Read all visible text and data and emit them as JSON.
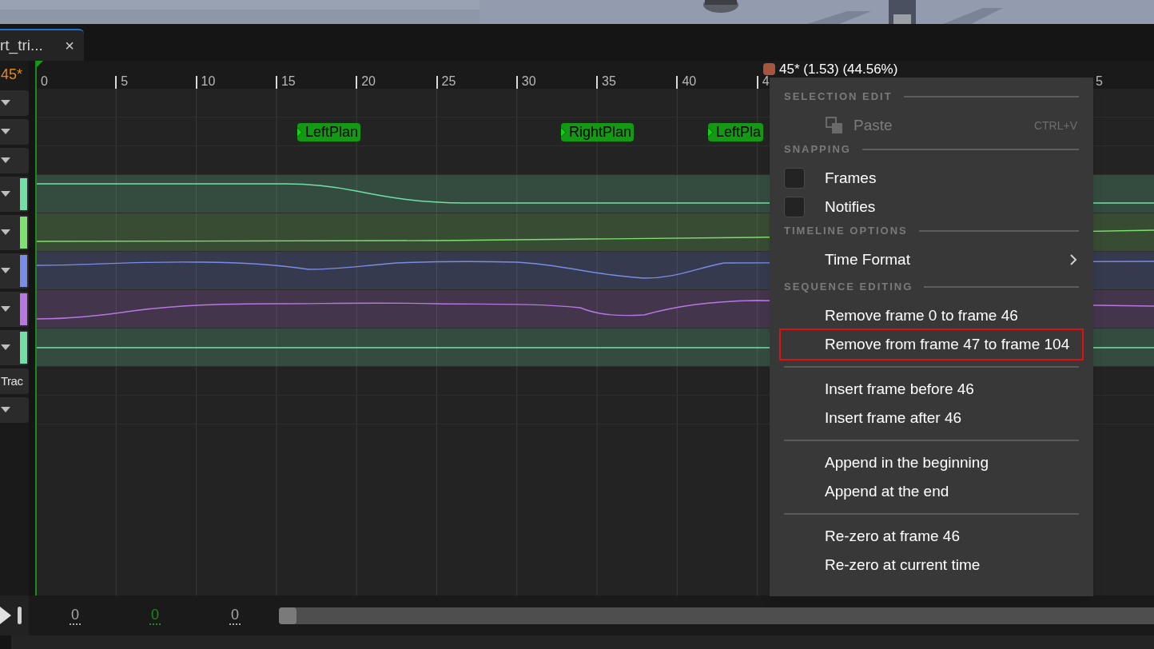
{
  "tab": {
    "title": "rt_tri...",
    "close": "×"
  },
  "current_frame": "45*",
  "ruler": {
    "ticks": [
      "0",
      "5",
      "10",
      "15",
      "20",
      "25",
      "30",
      "35",
      "40",
      "4",
      "5"
    ]
  },
  "playhead": {
    "label": "45* (1.53) (44.56%)"
  },
  "tracks": [
    {
      "kind": "plain"
    },
    {
      "kind": "notifies",
      "notifies": [
        "LeftPlan",
        "RightPlan",
        "LeftPla"
      ]
    },
    {
      "kind": "plain"
    },
    {
      "kind": "curve",
      "color": "#72e0a4"
    },
    {
      "kind": "curve",
      "color": "#7ee06e"
    },
    {
      "kind": "curve",
      "color": "#7a8de6"
    },
    {
      "kind": "curve",
      "color": "#b877e0"
    },
    {
      "kind": "curve",
      "color": "#72e0a4"
    },
    {
      "kind": "label",
      "label": "Trac"
    },
    {
      "kind": "plain"
    }
  ],
  "context_menu": {
    "items": [
      {
        "kind": "header",
        "label": "SELECTION EDIT"
      },
      {
        "kind": "item",
        "label": "Paste",
        "shortcut": "CTRL+V",
        "disabled": true,
        "highlighted": false
      },
      {
        "kind": "header",
        "label": "SNAPPING"
      },
      {
        "kind": "checkbox",
        "label": "Frames",
        "checked": false
      },
      {
        "kind": "checkbox",
        "label": "Notifies",
        "checked": false
      },
      {
        "kind": "header",
        "label": "TIMELINE OPTIONS"
      },
      {
        "kind": "submenu",
        "label": "Time Format"
      },
      {
        "kind": "header",
        "label": "SEQUENCE EDITING"
      },
      {
        "kind": "item",
        "label": "Remove frame 0 to frame 46",
        "disabled": false,
        "highlighted": false
      },
      {
        "kind": "item",
        "label": "Remove from frame 47 to frame 104",
        "disabled": false,
        "highlighted": true
      },
      {
        "kind": "divider"
      },
      {
        "kind": "item",
        "label": "Insert frame before 46",
        "disabled": false,
        "highlighted": false
      },
      {
        "kind": "item",
        "label": "Insert frame after 46",
        "disabled": false,
        "highlighted": false
      },
      {
        "kind": "divider"
      },
      {
        "kind": "item",
        "label": "Append in the beginning",
        "disabled": false,
        "highlighted": false
      },
      {
        "kind": "item",
        "label": "Append at the end",
        "disabled": false,
        "highlighted": false
      },
      {
        "kind": "divider"
      },
      {
        "kind": "item",
        "label": "Re-zero at frame 46",
        "disabled": false,
        "highlighted": false
      },
      {
        "kind": "item",
        "label": "Re-zero at current time",
        "disabled": false,
        "highlighted": false
      }
    ]
  },
  "transport": {
    "fields": [
      {
        "value": "0",
        "active": false
      },
      {
        "value": "0",
        "active": true
      },
      {
        "value": "0",
        "active": false
      }
    ],
    "scroll": {
      "level": 0.02
    }
  }
}
